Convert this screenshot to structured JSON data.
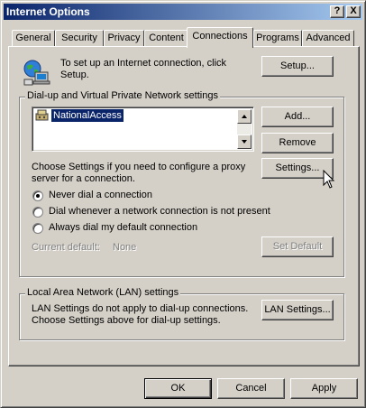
{
  "window": {
    "title": "Internet Options",
    "help_glyph": "?",
    "close_glyph": "X"
  },
  "tabs": [
    {
      "label": "General"
    },
    {
      "label": "Security"
    },
    {
      "label": "Privacy"
    },
    {
      "label": "Content"
    },
    {
      "label": "Connections",
      "active": true
    },
    {
      "label": "Programs"
    },
    {
      "label": "Advanced"
    }
  ],
  "setup": {
    "text": "To set up an Internet connection, click Setup.",
    "button": "Setup..."
  },
  "dialup": {
    "group_label": "Dial-up and Virtual Private Network settings",
    "connections": [
      "NationalAccess"
    ],
    "add_button": "Add...",
    "remove_button": "Remove",
    "settings_button": "Settings...",
    "hint": "Choose Settings if you need to configure a proxy server for a connection.",
    "options": [
      {
        "label": "Never dial a connection",
        "selected": true
      },
      {
        "label": "Dial whenever a network connection is not present",
        "selected": false
      },
      {
        "label": "Always dial my default connection",
        "selected": false
      }
    ],
    "current_default_label": "Current default:",
    "current_default_value": "None",
    "set_default_button": "Set Default"
  },
  "lan": {
    "group_label": "Local Area Network (LAN) settings",
    "text": "LAN Settings do not apply to dial-up connections. Choose Settings above for dial-up settings.",
    "button": "LAN Settings..."
  },
  "footer": {
    "ok": "OK",
    "cancel": "Cancel",
    "apply": "Apply"
  }
}
